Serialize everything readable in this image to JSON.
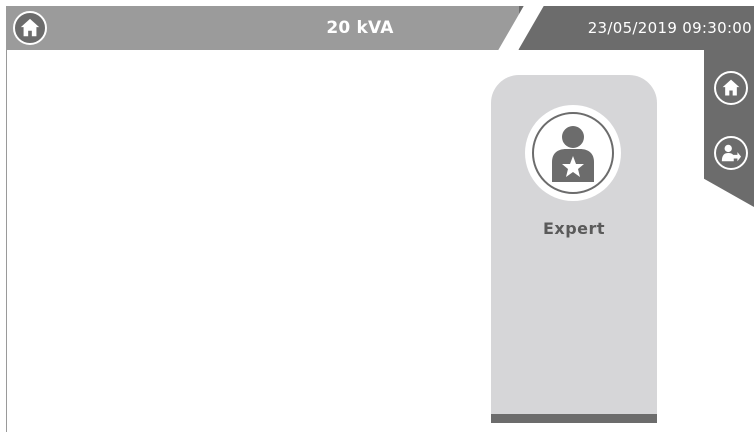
{
  "header": {
    "title": "20 kVA",
    "datetime": "23/05/2019 09:30:00"
  },
  "user_card": {
    "label": "Expert"
  },
  "icons": {
    "top_home": "home-icon",
    "side_home": "home-icon",
    "side_logout": "user-logout-icon",
    "avatar": "expert-user-star-icon"
  },
  "colors": {
    "bar_gray": "#9b9b9b",
    "dark_gray": "#6c6c6c",
    "card_gray": "#d6d6d8"
  }
}
